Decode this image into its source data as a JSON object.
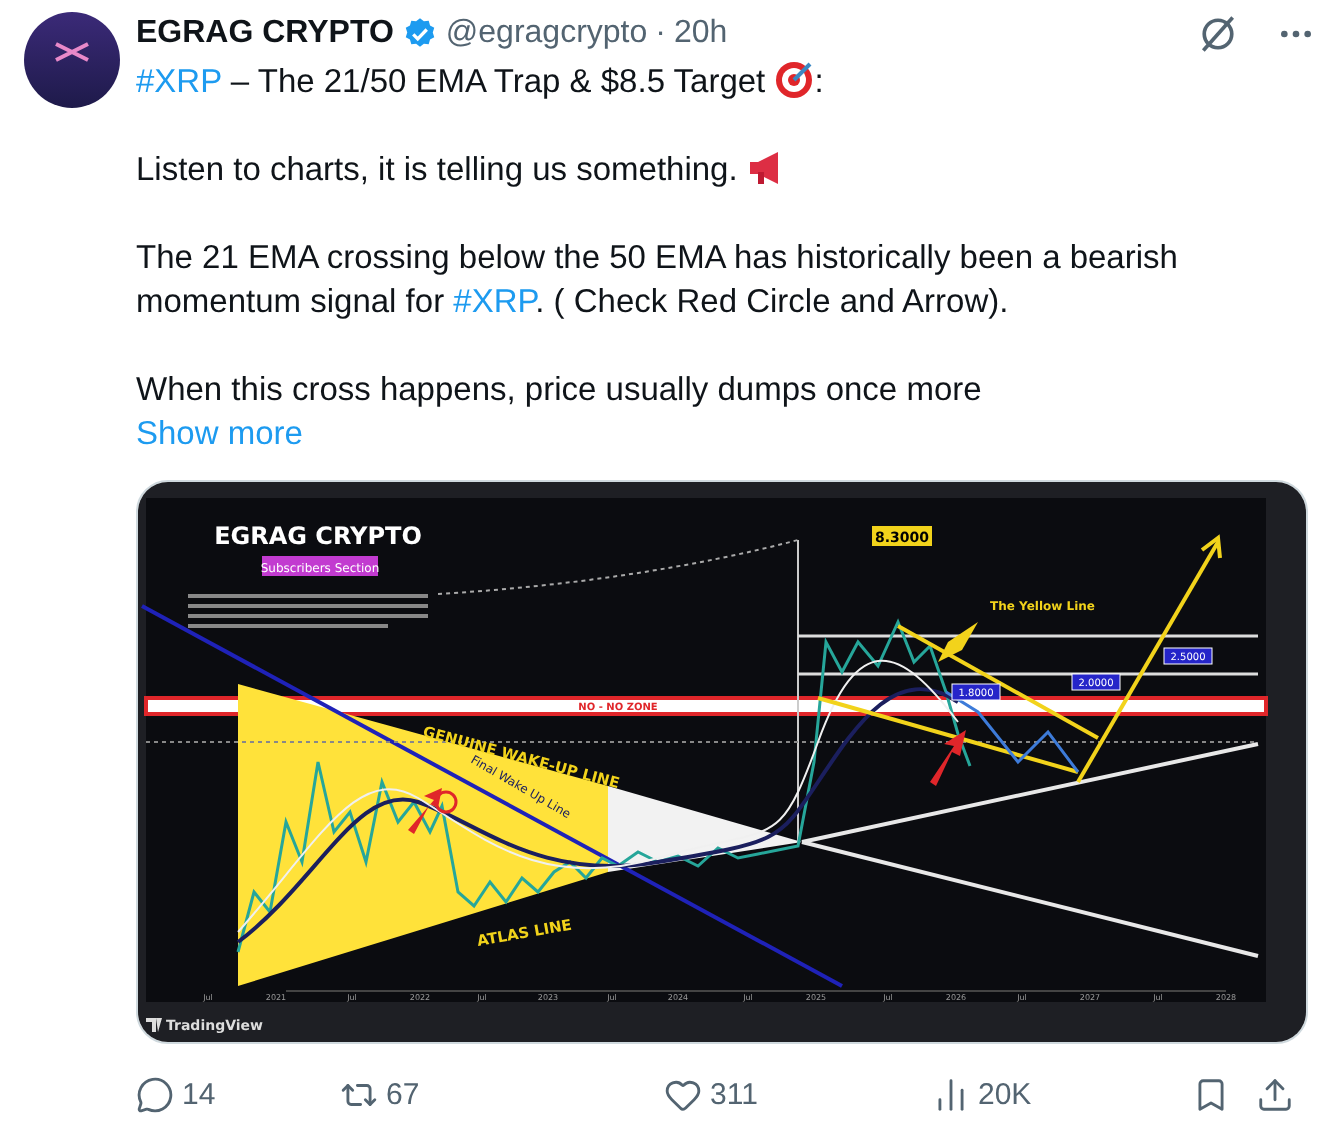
{
  "author": {
    "name": "EGRAG CRYPTO",
    "verified": true,
    "handle": "@egragcrypto",
    "separator": "·",
    "time": "20h"
  },
  "post": {
    "title": {
      "hashtag": "#XRP",
      "text": "– The 21/50 EMA Trap & $8.5 Target",
      "suffix": ":"
    },
    "line": "Listen to charts, it is telling us something.",
    "paragraph": {
      "before": "The 21 EMA crossing below the 50 EMA has historically been a bearish momentum signal for ",
      "hashtag": "#XRP",
      "after": ". ( Check Red Circle and Arrow)."
    },
    "last": "When this cross happens, price usually dumps once more",
    "show_more": "Show more"
  },
  "chart_image": {
    "title": "EGRAG CRYPTO",
    "subtitle": "Subscribers Section",
    "zone_label": "NO - NO ZONE",
    "wake_up_label": "GENUINE WAKE-UP LINE",
    "final_label": "Final Wake Up Line",
    "atlas_label": "ATLAS LINE",
    "target_label": "8.3000",
    "yellow_line_label": "The Yellow Line",
    "level_labels": [
      "1.8000",
      "2.0000",
      "2.5000"
    ],
    "x_axis": [
      "Jul",
      "2021",
      "Jul",
      "2022",
      "Jul",
      "2023",
      "Jul",
      "2024",
      "Jul",
      "2025",
      "Jul",
      "2026",
      "Jul",
      "2027",
      "Jul",
      "2028"
    ],
    "brand": "TradingView"
  },
  "actions": [
    {
      "kind": "reply",
      "count": "14"
    },
    {
      "kind": "repost",
      "count": "67"
    },
    {
      "kind": "like",
      "count": "311"
    },
    {
      "kind": "views",
      "count": "20K"
    },
    {
      "kind": "bookmark"
    },
    {
      "kind": "share"
    }
  ]
}
